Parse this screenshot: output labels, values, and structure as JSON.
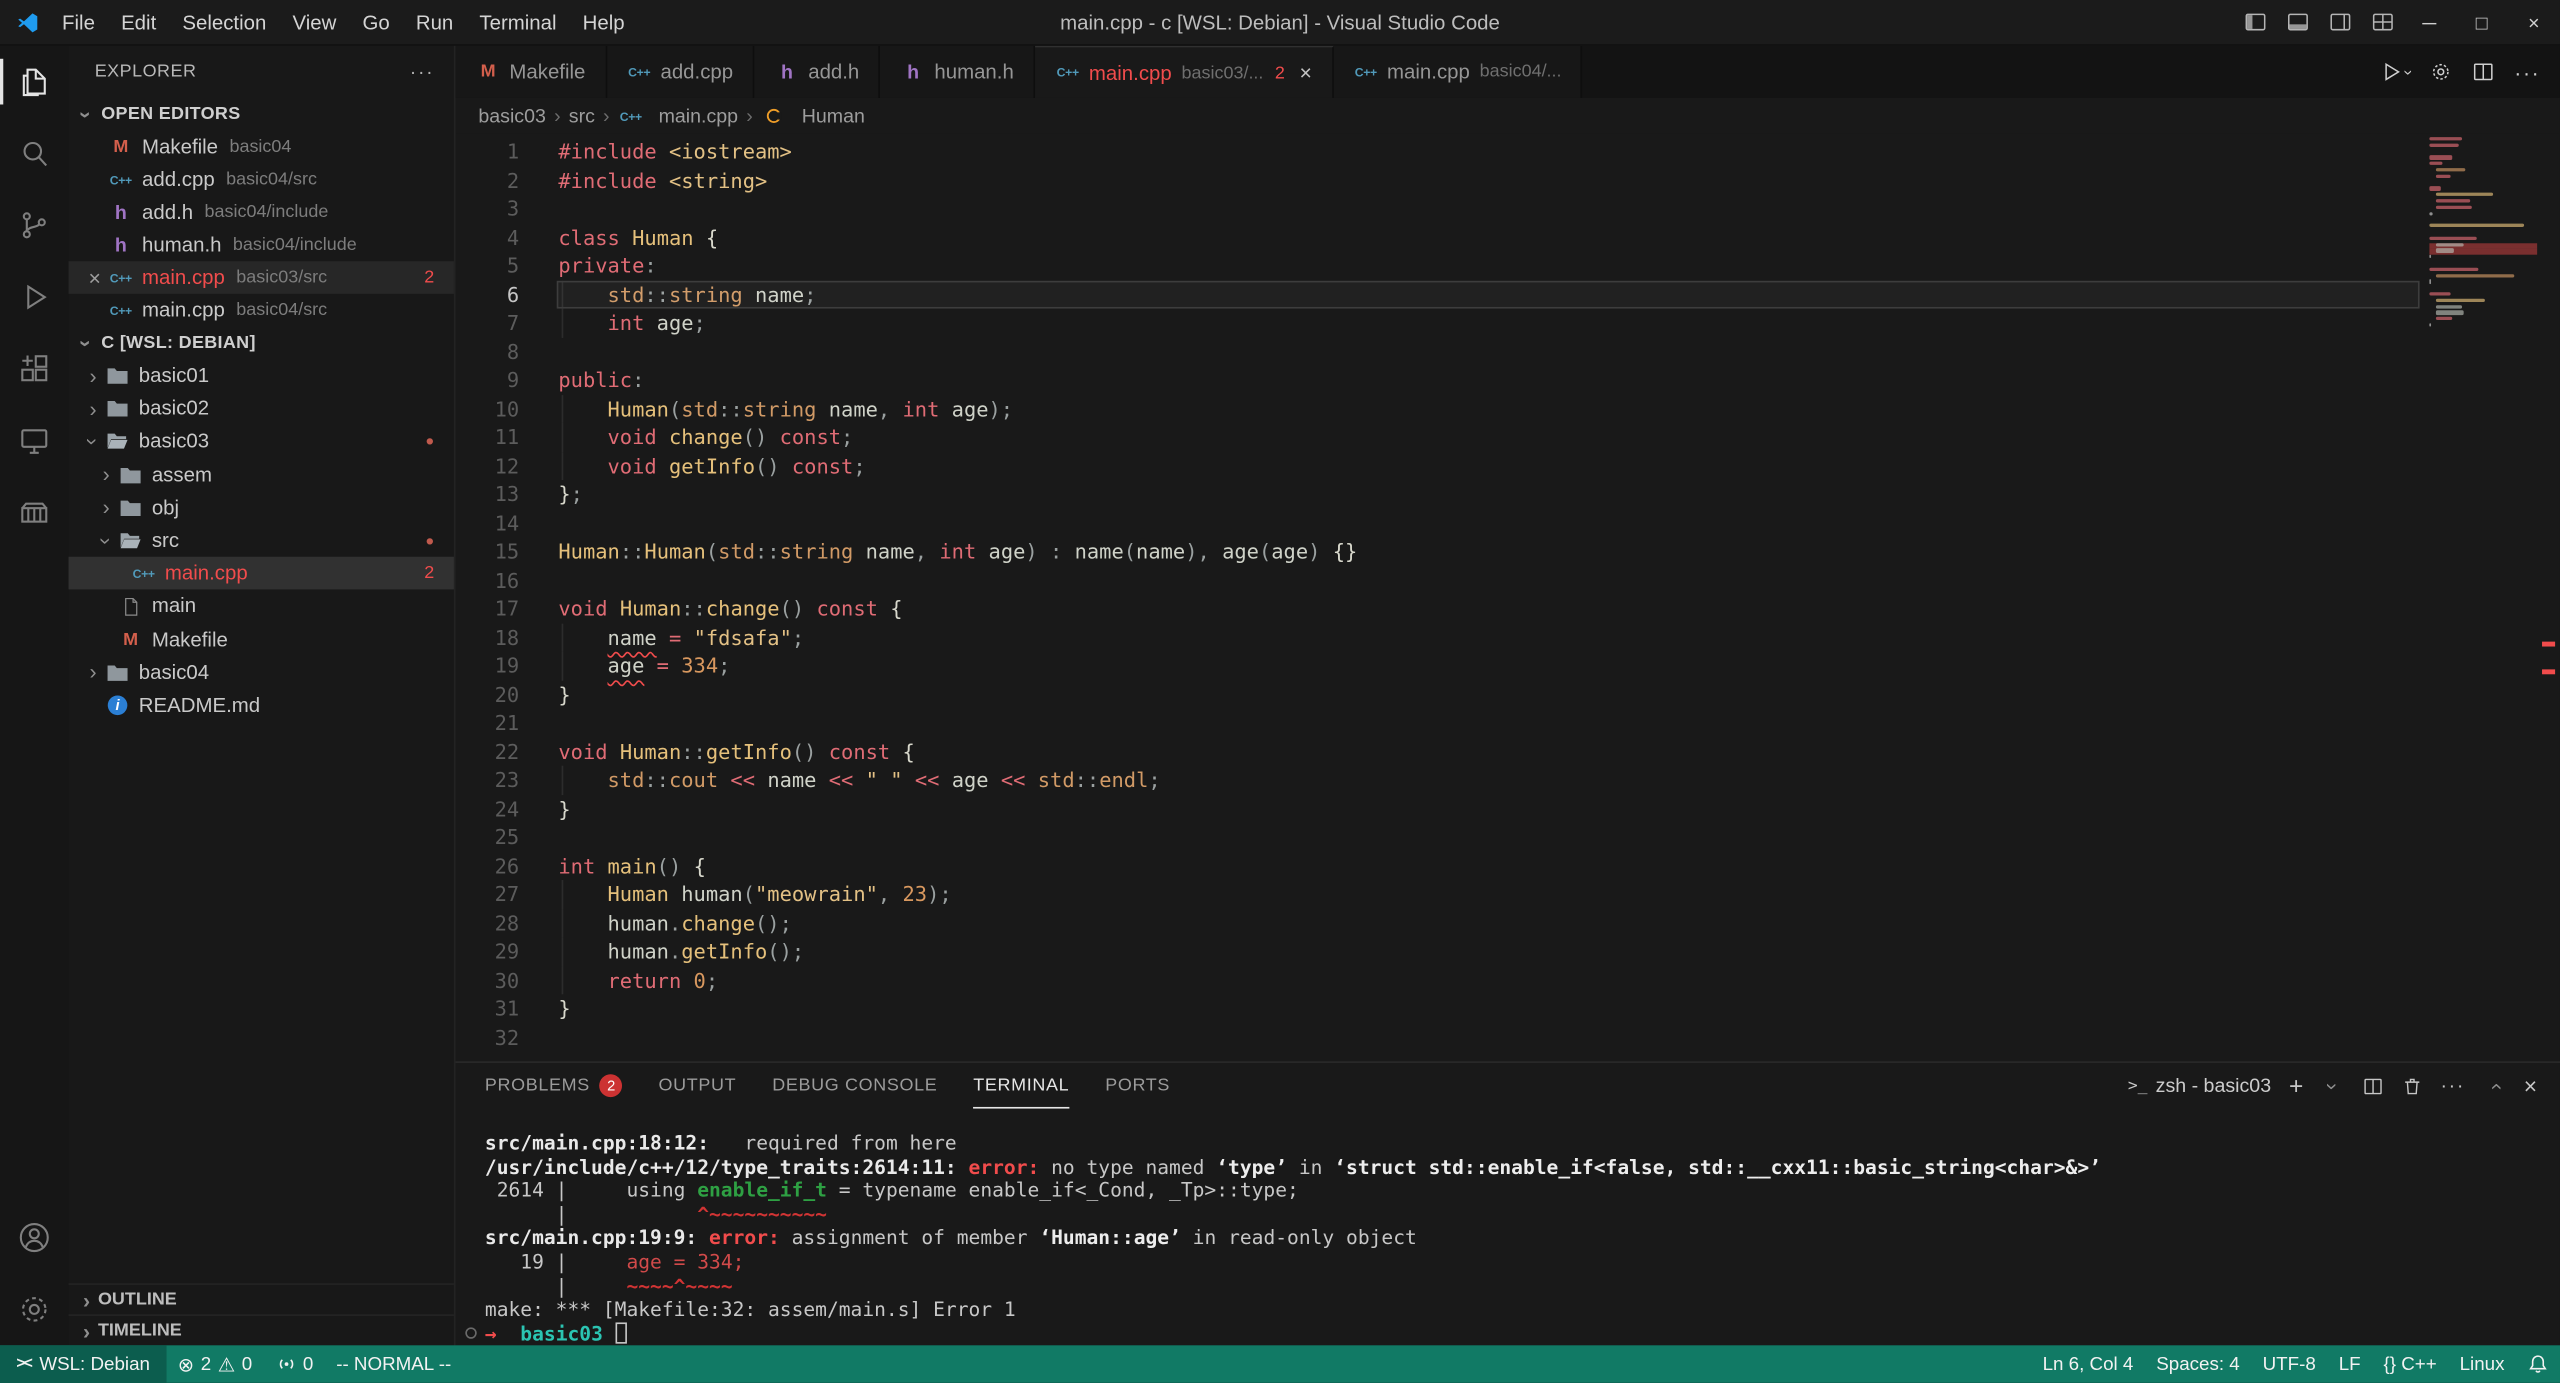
{
  "titlebar": {
    "menus": [
      "File",
      "Edit",
      "Selection",
      "View",
      "Go",
      "Run",
      "Terminal",
      "Help"
    ],
    "title": "main.cpp - c [WSL: Debian] - Visual Studio Code",
    "window_controls": {
      "minimize": "─",
      "maximize": "□",
      "close": "×"
    }
  },
  "activity_bar": {
    "top": [
      {
        "name": "explorer",
        "active": true
      },
      {
        "name": "search"
      },
      {
        "name": "source-control"
      },
      {
        "name": "run-debug"
      },
      {
        "name": "extensions"
      },
      {
        "name": "remote-explorer"
      },
      {
        "name": "containers"
      }
    ],
    "bottom": [
      {
        "name": "account"
      },
      {
        "name": "manage"
      }
    ]
  },
  "sidebar": {
    "title": "EXPLORER",
    "more_label": "···",
    "open_editors": {
      "label": "OPEN EDITORS",
      "items": [
        {
          "icon": "make",
          "label": "Makefile",
          "desc": "basic04"
        },
        {
          "icon": "cpp",
          "label": "add.cpp",
          "desc": "basic04/src"
        },
        {
          "icon": "h",
          "label": "add.h",
          "desc": "basic04/include"
        },
        {
          "icon": "h",
          "label": "human.h",
          "desc": "basic04/include"
        },
        {
          "icon": "cpp",
          "label": "main.cpp",
          "desc": "basic03/src",
          "error": true,
          "badge": "2",
          "close": true,
          "active": true
        },
        {
          "icon": "cpp",
          "label": "main.cpp",
          "desc": "basic04/src"
        }
      ]
    },
    "workspace": {
      "label": "C [WSL: DEBIAN]",
      "tree": [
        {
          "depth": 0,
          "chevron": "right",
          "icon": "folder",
          "label": "basic01"
        },
        {
          "depth": 0,
          "chevron": "right",
          "icon": "folder",
          "label": "basic02"
        },
        {
          "depth": 0,
          "chevron": "down",
          "icon": "folder-open",
          "label": "basic03",
          "dot": true
        },
        {
          "depth": 1,
          "chevron": "right",
          "icon": "folder",
          "label": "assem"
        },
        {
          "depth": 1,
          "chevron": "right",
          "icon": "folder",
          "label": "obj"
        },
        {
          "depth": 1,
          "chevron": "down",
          "icon": "folder-open",
          "label": "src",
          "dot": true
        },
        {
          "depth": 2,
          "icon": "cpp",
          "label": "main.cpp",
          "error": true,
          "badge": "2",
          "selected": true
        },
        {
          "depth": 1,
          "icon": "file",
          "label": "main"
        },
        {
          "depth": 1,
          "icon": "make",
          "label": "Makefile"
        },
        {
          "depth": 0,
          "chevron": "right",
          "icon": "folder",
          "label": "basic04"
        },
        {
          "depth": 0,
          "icon": "info",
          "label": "README.md"
        }
      ]
    },
    "outline_label": "OUTLINE",
    "timeline_label": "TIMELINE"
  },
  "editor": {
    "tabs": [
      {
        "icon": "make",
        "label": "Makefile"
      },
      {
        "icon": "cpp",
        "label": "add.cpp"
      },
      {
        "icon": "h",
        "label": "add.h"
      },
      {
        "icon": "h",
        "label": "human.h"
      },
      {
        "icon": "cpp",
        "label": "main.cpp",
        "desc": "basic03/...",
        "badge": "2",
        "active": true,
        "error": true,
        "close": "×"
      },
      {
        "icon": "cpp",
        "label": "main.cpp",
        "desc": "basic04/..."
      }
    ],
    "breadcrumbs": [
      {
        "label": "basic03"
      },
      {
        "label": "src"
      },
      {
        "label": "main.cpp",
        "icon": "cpp"
      },
      {
        "label": "Human",
        "icon": "class"
      }
    ],
    "code": {
      "current_line": 6,
      "error_lines": [
        18,
        19
      ],
      "lines": [
        [
          [
            "kw",
            "#include"
          ],
          [
            "pl",
            " "
          ],
          [
            "str",
            "<iostream>"
          ]
        ],
        [
          [
            "kw",
            "#include"
          ],
          [
            "pl",
            " "
          ],
          [
            "str",
            "<string>"
          ]
        ],
        [],
        [
          [
            "kw",
            "class"
          ],
          [
            "pl",
            " "
          ],
          [
            "type",
            "Human"
          ],
          [
            "pl",
            " "
          ],
          [
            "br",
            "{"
          ]
        ],
        [
          [
            "kw",
            "private"
          ],
          [
            "pu",
            ":"
          ]
        ],
        [
          [
            "pl",
            "    "
          ],
          [
            "std",
            "std"
          ],
          [
            "pu",
            "::"
          ],
          [
            "std",
            "string"
          ],
          [
            "pl",
            " "
          ],
          [
            "var",
            "name"
          ],
          [
            "pu",
            ";"
          ]
        ],
        [
          [
            "pl",
            "    "
          ],
          [
            "kw",
            "int"
          ],
          [
            "pl",
            " "
          ],
          [
            "var",
            "age"
          ],
          [
            "pu",
            ";"
          ]
        ],
        [],
        [
          [
            "kw",
            "public"
          ],
          [
            "pu",
            ":"
          ]
        ],
        [
          [
            "pl",
            "    "
          ],
          [
            "type",
            "Human"
          ],
          [
            "pu",
            "("
          ],
          [
            "std",
            "std"
          ],
          [
            "pu",
            "::"
          ],
          [
            "std",
            "string"
          ],
          [
            "pl",
            " "
          ],
          [
            "var",
            "name"
          ],
          [
            "pu",
            ","
          ],
          [
            "pl",
            " "
          ],
          [
            "kw",
            "int"
          ],
          [
            "pl",
            " "
          ],
          [
            "var",
            "age"
          ],
          [
            "pu",
            ");"
          ]
        ],
        [
          [
            "pl",
            "    "
          ],
          [
            "kw",
            "void"
          ],
          [
            "pl",
            " "
          ],
          [
            "fn",
            "change"
          ],
          [
            "pu",
            "()"
          ],
          [
            "pl",
            " "
          ],
          [
            "kw",
            "const"
          ],
          [
            "pu",
            ";"
          ]
        ],
        [
          [
            "pl",
            "    "
          ],
          [
            "kw",
            "void"
          ],
          [
            "pl",
            " "
          ],
          [
            "fn",
            "getInfo"
          ],
          [
            "pu",
            "()"
          ],
          [
            "pl",
            " "
          ],
          [
            "kw",
            "const"
          ],
          [
            "pu",
            ";"
          ]
        ],
        [
          [
            "br",
            "}"
          ],
          [
            "pu",
            ";"
          ]
        ],
        [],
        [
          [
            "type",
            "Human"
          ],
          [
            "pu",
            "::"
          ],
          [
            "fn",
            "Human"
          ],
          [
            "pu",
            "("
          ],
          [
            "std",
            "std"
          ],
          [
            "pu",
            "::"
          ],
          [
            "std",
            "string"
          ],
          [
            "pl",
            " "
          ],
          [
            "var",
            "name"
          ],
          [
            "pu",
            ","
          ],
          [
            "pl",
            " "
          ],
          [
            "kw",
            "int"
          ],
          [
            "pl",
            " "
          ],
          [
            "var",
            "age"
          ],
          [
            "pu",
            ")"
          ],
          [
            "pl",
            " "
          ],
          [
            "pu",
            ":"
          ],
          [
            "pl",
            " "
          ],
          [
            "var",
            "name"
          ],
          [
            "pu",
            "("
          ],
          [
            "var",
            "name"
          ],
          [
            "pu",
            "),"
          ],
          [
            "pl",
            " "
          ],
          [
            "var",
            "age"
          ],
          [
            "pu",
            "("
          ],
          [
            "var",
            "age"
          ],
          [
            "pu",
            ")"
          ],
          [
            "pl",
            " "
          ],
          [
            "br",
            "{}"
          ]
        ],
        [],
        [
          [
            "kw",
            "void"
          ],
          [
            "pl",
            " "
          ],
          [
            "type",
            "Human"
          ],
          [
            "pu",
            "::"
          ],
          [
            "fn",
            "change"
          ],
          [
            "pu",
            "()"
          ],
          [
            "pl",
            " "
          ],
          [
            "kw",
            "const"
          ],
          [
            "pl",
            " "
          ],
          [
            "br",
            "{"
          ]
        ],
        [
          [
            "pl",
            "    "
          ],
          [
            "var sq",
            "name"
          ],
          [
            "pl",
            " "
          ],
          [
            "op",
            "="
          ],
          [
            "pl",
            " "
          ],
          [
            "str",
            "\"fdsafa\""
          ],
          [
            "pu",
            ";"
          ]
        ],
        [
          [
            "pl",
            "    "
          ],
          [
            "var sq",
            "age"
          ],
          [
            "pl",
            " "
          ],
          [
            "op",
            "="
          ],
          [
            "pl",
            " "
          ],
          [
            "num",
            "334"
          ],
          [
            "pu",
            ";"
          ]
        ],
        [
          [
            "br",
            "}"
          ]
        ],
        [],
        [
          [
            "kw",
            "void"
          ],
          [
            "pl",
            " "
          ],
          [
            "type",
            "Human"
          ],
          [
            "pu",
            "::"
          ],
          [
            "fn",
            "getInfo"
          ],
          [
            "pu",
            "()"
          ],
          [
            "pl",
            " "
          ],
          [
            "kw",
            "const"
          ],
          [
            "pl",
            " "
          ],
          [
            "br",
            "{"
          ]
        ],
        [
          [
            "pl",
            "    "
          ],
          [
            "std",
            "std"
          ],
          [
            "pu",
            "::"
          ],
          [
            "std",
            "cout"
          ],
          [
            "pl",
            " "
          ],
          [
            "op",
            "<<"
          ],
          [
            "pl",
            " "
          ],
          [
            "var",
            "name"
          ],
          [
            "pl",
            " "
          ],
          [
            "op",
            "<<"
          ],
          [
            "pl",
            " "
          ],
          [
            "str",
            "\" \""
          ],
          [
            "pl",
            " "
          ],
          [
            "op",
            "<<"
          ],
          [
            "pl",
            " "
          ],
          [
            "var",
            "age"
          ],
          [
            "pl",
            " "
          ],
          [
            "op",
            "<<"
          ],
          [
            "pl",
            " "
          ],
          [
            "std",
            "std"
          ],
          [
            "pu",
            "::"
          ],
          [
            "std",
            "endl"
          ],
          [
            "pu",
            ";"
          ]
        ],
        [
          [
            "br",
            "}"
          ]
        ],
        [],
        [
          [
            "kw",
            "int"
          ],
          [
            "pl",
            " "
          ],
          [
            "fn",
            "main"
          ],
          [
            "pu",
            "()"
          ],
          [
            "pl",
            " "
          ],
          [
            "br",
            "{"
          ]
        ],
        [
          [
            "pl",
            "    "
          ],
          [
            "type",
            "Human"
          ],
          [
            "pl",
            " "
          ],
          [
            "var",
            "human"
          ],
          [
            "pu",
            "("
          ],
          [
            "str",
            "\"meowrain\""
          ],
          [
            "pu",
            ","
          ],
          [
            "pl",
            " "
          ],
          [
            "num",
            "23"
          ],
          [
            "pu",
            ");"
          ]
        ],
        [
          [
            "pl",
            "    "
          ],
          [
            "var",
            "human"
          ],
          [
            "pu",
            "."
          ],
          [
            "fn",
            "change"
          ],
          [
            "pu",
            "();"
          ]
        ],
        [
          [
            "pl",
            "    "
          ],
          [
            "var",
            "human"
          ],
          [
            "pu",
            "."
          ],
          [
            "fn",
            "getInfo"
          ],
          [
            "pu",
            "();"
          ]
        ],
        [
          [
            "pl",
            "    "
          ],
          [
            "kw",
            "return"
          ],
          [
            "pl",
            " "
          ],
          [
            "num",
            "0"
          ],
          [
            "pu",
            ";"
          ]
        ],
        [
          [
            "br",
            "}"
          ]
        ],
        []
      ]
    }
  },
  "panel": {
    "tabs": [
      {
        "label": "PROBLEMS",
        "badge": "2"
      },
      {
        "label": "OUTPUT"
      },
      {
        "label": "DEBUG CONSOLE"
      },
      {
        "label": "TERMINAL",
        "active": true
      },
      {
        "label": "PORTS"
      }
    ],
    "terminal_title": "zsh - basic03",
    "terminal_lines": [
      {
        "tokens": [
          [
            "b",
            "src/main.cpp:18:12:"
          ],
          [
            "n",
            "   required from here"
          ]
        ]
      },
      {
        "tokens": [
          [
            "b",
            "/usr/include/c++/12/type_traits:2614:11:"
          ],
          [
            "n",
            " "
          ],
          [
            "err",
            "error:"
          ],
          [
            "n",
            " no type named "
          ],
          [
            "bq",
            "‘type’"
          ],
          [
            "n",
            " in "
          ],
          [
            "bq",
            "‘struct std::enable_if<false, std::__cxx11::basic_string<char>&>’"
          ]
        ]
      },
      {
        "tokens": [
          [
            "n",
            " 2614 |     using "
          ],
          [
            "grn",
            "enable_if_t"
          ],
          [
            "n",
            " = typename enable_if<_Cond, _Tp>::type;"
          ]
        ]
      },
      {
        "tokens": [
          [
            "n",
            "      |           "
          ],
          [
            "caret",
            "^~~~~~~~~~~"
          ]
        ]
      },
      {
        "tokens": [
          [
            "b",
            "src/main.cpp:19:9:"
          ],
          [
            "n",
            " "
          ],
          [
            "err",
            "error:"
          ],
          [
            "n",
            " assignment of member "
          ],
          [
            "bq",
            "‘Human::age’"
          ],
          [
            "n",
            " in read-only object"
          ]
        ]
      },
      {
        "tokens": [
          [
            "n",
            "   19 |     "
          ],
          [
            "red",
            "age = 334;"
          ]
        ]
      },
      {
        "tokens": [
          [
            "n",
            "      |     "
          ],
          [
            "caret",
            "~~~~^~~~~"
          ]
        ]
      },
      {
        "tokens": [
          [
            "n",
            "make: *** [Makefile:32: assem/main.s] Error 1"
          ]
        ]
      },
      {
        "deco": true,
        "tokens": [
          [
            "arrow",
            "→"
          ],
          [
            "n",
            "  "
          ],
          [
            "cyan",
            "basic03"
          ],
          [
            "n",
            " "
          ],
          [
            "cursor",
            ""
          ]
        ]
      }
    ]
  },
  "status_bar": {
    "remote": "WSL: Debian",
    "errors": "2",
    "warnings": "0",
    "ports": "0",
    "vim_mode": "-- NORMAL --",
    "right": [
      {
        "name": "cursor-position",
        "label": "Ln 6, Col 4"
      },
      {
        "name": "indentation",
        "label": "Spaces: 4"
      },
      {
        "name": "encoding",
        "label": "UTF-8"
      },
      {
        "name": "eol",
        "label": "LF"
      },
      {
        "name": "language-mode",
        "label": "{} C++"
      },
      {
        "name": "cpp-configuration",
        "label": "Linux"
      }
    ]
  },
  "colors": {
    "status_bar": "#117a65",
    "status_bar_remote": "#0c5d4e",
    "error": "#f14c4c",
    "keyword": "#e06c75",
    "type": "#e5c07b",
    "number": "#d19a66",
    "cpp_icon": "#519aba"
  }
}
